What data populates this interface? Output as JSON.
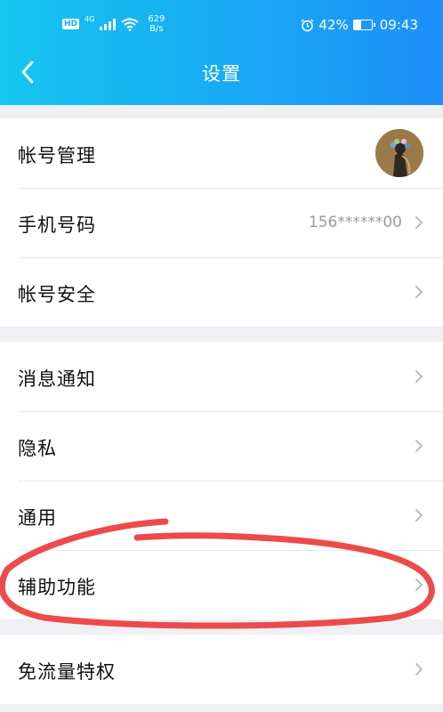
{
  "status_bar": {
    "hd_label": "HD",
    "network_label": "4G",
    "speed_value": "629",
    "speed_unit": "B/s",
    "battery": "42%",
    "battery_level": 0.42,
    "time": "09:43",
    "icons": [
      "signal-icon",
      "wifi-icon",
      "alarm-icon",
      "battery-icon"
    ]
  },
  "nav": {
    "title": "设置",
    "back_icon": "chevron-left-icon"
  },
  "groups": [
    {
      "items": [
        {
          "label": "帐号管理",
          "value": "",
          "trailing": "avatar"
        },
        {
          "label": "手机号码",
          "value": "156******00",
          "trailing": "chevron"
        },
        {
          "label": "帐号安全",
          "value": "",
          "trailing": "chevron"
        }
      ]
    },
    {
      "items": [
        {
          "label": "消息通知",
          "value": "",
          "trailing": "chevron"
        },
        {
          "label": "隐私",
          "value": "",
          "trailing": "chevron"
        },
        {
          "label": "通用",
          "value": "",
          "trailing": "chevron"
        },
        {
          "label": "辅助功能",
          "value": "",
          "trailing": "chevron"
        }
      ]
    },
    {
      "items": [
        {
          "label": "免流量特权",
          "value": "",
          "trailing": "chevron"
        }
      ]
    }
  ],
  "colors": {
    "header_start": "#15c6ef",
    "header_end": "#1c8ff8",
    "annotation": "#ec4b4b",
    "background": "#eff0f4"
  }
}
